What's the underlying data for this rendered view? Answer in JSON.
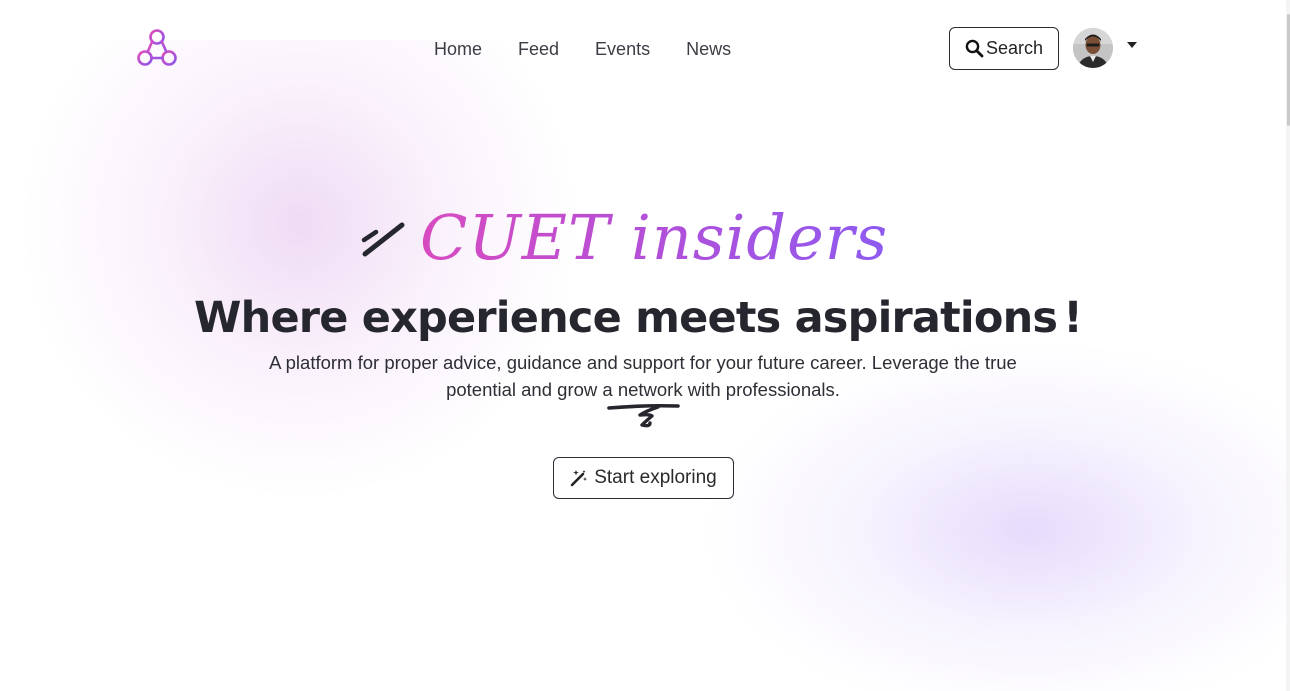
{
  "navbar": {
    "links": [
      {
        "label": "Home"
      },
      {
        "label": "Feed"
      },
      {
        "label": "Events"
      },
      {
        "label": "News"
      }
    ],
    "search_label": "Search",
    "logo_icon": "three-circles-logo-icon",
    "search_icon": "search-icon",
    "avatar_icon": "user-avatar",
    "dropdown_icon": "caret-down-icon"
  },
  "hero": {
    "brand": "CUET insiders",
    "headline": "Where experience meets aspirations",
    "headline_punct": "!",
    "subtitle": "A platform for proper advice, guidance and support for your future career. Leverage the true potential and grow a network with professionals.",
    "cta_label": "Start exploring",
    "cta_icon": "magic-wand-icon"
  },
  "colors": {
    "brand_gradient_start": "#d84bc0",
    "brand_gradient_end": "#8e5af0",
    "text_dark": "#26262e",
    "border": "#2b2b33"
  }
}
